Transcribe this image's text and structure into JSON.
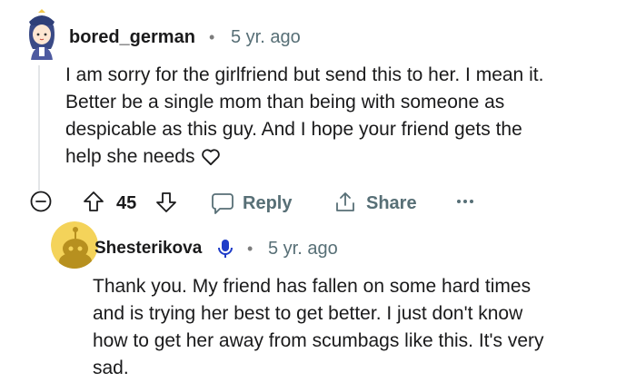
{
  "comment": {
    "username": "bored_german",
    "separator": "•",
    "time": "5 yr. ago",
    "body_lines": [
      "I am sorry for the girlfriend but send this to her. I mean it.",
      "Better be a single mom than being with someone as",
      "despicable as this guy. And I hope your friend gets the",
      "help she needs"
    ],
    "actions": {
      "vote_count": "45",
      "reply_label": "Reply",
      "share_label": "Share"
    }
  },
  "reply": {
    "username": "Shesterikova",
    "separator": "•",
    "time": "5 yr. ago",
    "body_lines": [
      "Thank you. My friend has fallen on some hard times",
      "and is trying her best to get better. I just don't know",
      "how to get her away from scumbags like this. It's very",
      "sad."
    ]
  },
  "icons": {
    "collapse": "minus-circle-icon",
    "upvote": "upvote-arrow-icon",
    "downvote": "downvote-arrow-icon",
    "reply": "chat-bubble-icon",
    "share": "share-icon",
    "more": "more-dots-icon",
    "heart": "heart-icon",
    "op_badge": "microphone-icon"
  },
  "colors": {
    "text": "#1a1a1b",
    "meta": "#576f76",
    "avatar2_bg": "#f4d35a",
    "thread_line": "#e4e6e8"
  }
}
